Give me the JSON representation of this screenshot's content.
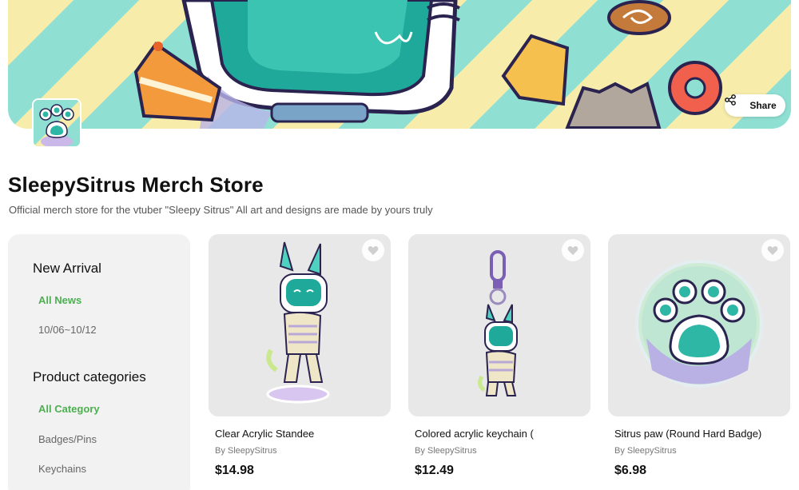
{
  "banner": {
    "share_label": "Share"
  },
  "store": {
    "title": "SleepySitrus Merch Store",
    "description": "Official merch store for the vtuber \"Sleepy Sitrus\" All art and designs are made by yours truly"
  },
  "sidebar": {
    "new_arrival": {
      "heading": "New Arrival",
      "items": [
        "All News",
        "10/06~10/12"
      ]
    },
    "categories": {
      "heading": "Product categories",
      "items": [
        "All Category",
        "Badges/Pins",
        "Keychains"
      ]
    }
  },
  "products": [
    {
      "name": "Clear Acrylic Standee",
      "by": "By SleepySitrus",
      "price": "$14.98"
    },
    {
      "name": "Colored acrylic keychain (",
      "by": "By SleepySitrus",
      "price": "$12.49"
    },
    {
      "name": "Sitrus paw (Round Hard Badge)",
      "by": "By SleepySitrus",
      "price": "$6.98"
    }
  ],
  "colors": {
    "accent_green": "#4caf50",
    "banner_yellow": "#f7ecaa",
    "banner_teal": "#8fe0d3"
  },
  "icons": {
    "share": "share-icon",
    "favorite": "heart-icon"
  }
}
